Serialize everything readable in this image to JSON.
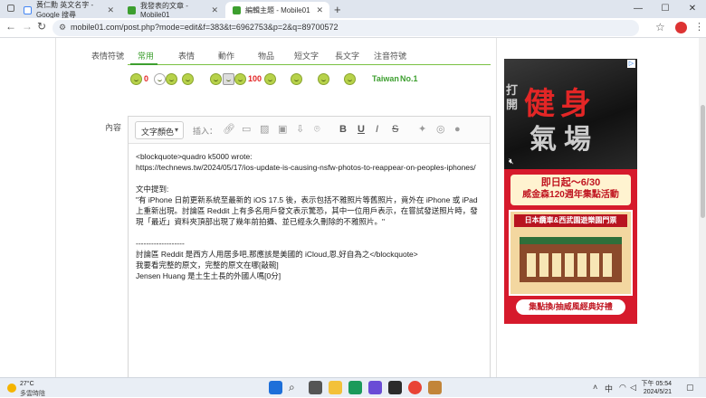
{
  "browser": {
    "tabs": [
      {
        "title": "黃仁勳 英文名字 - Google 搜尋",
        "active": false
      },
      {
        "title": "我發表的文章 - Mobile01",
        "active": false
      },
      {
        "title": "編輯主題 - Mobile01",
        "active": true
      }
    ],
    "new_tab": "+",
    "url": "mobile01.com/post.php?mode=edit&f=383&t=6962753&p=2&q=89700572",
    "controls": {
      "minimize": "—",
      "maximize": "☐",
      "close": "✕"
    }
  },
  "editor": {
    "emoji_label": "表情符號",
    "emoji_tabs": [
      "常用",
      "表情",
      "動作",
      "物品",
      "短文字",
      "長文字",
      "注音符號"
    ],
    "active_tab": "常用",
    "emoji_row": [
      {
        "kind": "text",
        "text": "0",
        "color": "#e32626"
      },
      {
        "kind": "text",
        "text": "100",
        "color": "#e32626"
      },
      {
        "kind": "text",
        "text": "Taiwan",
        "color": "#3d9f2f"
      },
      {
        "kind": "text",
        "text": "No.1",
        "color": "#3d9f2f"
      }
    ],
    "content_label": "內容",
    "color_select": "文字顏色",
    "insert_label": "插入：",
    "content_lines": [
      "<blockquote>quadro k5000 wrote:",
      "https://technews.tw/2024/05/17/ios-update-is-causing-nsfw-photos-to-reappear-on-peoples-iphones/",
      "",
      "文中提到:",
      "\"有 iPhone 日前更新系統至最新的 iOS 17.5 後，表示包括不雅照片等舊照片，竟外在 iPhone 或 iPad 上重新出現。討論區 Reddit 上有多名用戶發文表示驚恐，其中一位用戶表示，在嘗試發送照片時，發現「最近」資料夾頂部出現了幾年前拍攝、並已經永久刪除的不雅照片。\"",
      "",
      "-------------------",
      "討論區 Reddit 是西方人用居多吧,那應該是美國的 iCloud,恩,好自為之</blockquote>",
      "我要看完整的原文，完整的原文在哪[敲碗]",
      "Jensen Huang 是土生土長的外國人嗎[0分]"
    ]
  },
  "ad": {
    "top_chars": [
      "打",
      "開",
      "健",
      "身",
      "氣",
      "場"
    ],
    "headline": "即日起～6/30",
    "subheadline": "威金森120週年集點活動",
    "banner": "日本纜車&西武園遊樂園門票",
    "cta": "集點換/抽威風經典好禮"
  },
  "taskbar": {
    "weather_temp": "27°C",
    "weather_desc": "多雲時陰",
    "time": "下午 05:54",
    "date": "2024/5/21",
    "ime": "中"
  }
}
